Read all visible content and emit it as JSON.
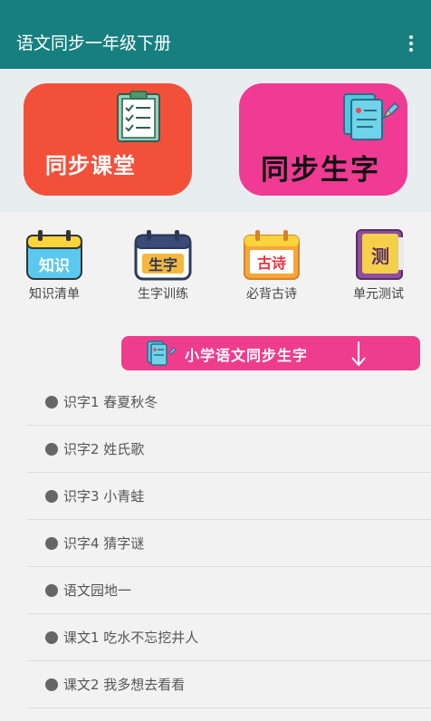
{
  "appbar": {
    "title": "语文同步一年级下册",
    "menu_icon": "more-vert-icon"
  },
  "banners": [
    {
      "label": "同步课堂",
      "icon": "clipboard-icon",
      "color": "#f3503a"
    },
    {
      "label": "同步生字",
      "icon": "notebook-pen-icon",
      "color": "#f03a93"
    }
  ],
  "grid": [
    {
      "label": "知识清单",
      "icon_text": "知识",
      "icon": "calendar-knowledge-icon"
    },
    {
      "label": "生字训练",
      "icon_text": "生字",
      "icon": "calendar-characters-icon"
    },
    {
      "label": "必背古诗",
      "icon_text": "古诗",
      "icon": "calendar-poem-icon"
    },
    {
      "label": "单元测试",
      "icon_text": "测",
      "icon": "test-book-icon"
    }
  ],
  "section": {
    "label": "小学语文同步生字",
    "icon": "notebook-pen-icon",
    "arrow_icon": "arrow-down-icon"
  },
  "lessons": [
    {
      "label": "识字1 春夏秋冬"
    },
    {
      "label": "识字2 姓氏歌"
    },
    {
      "label": "识字3 小青蛙"
    },
    {
      "label": "识字4 猜字谜"
    },
    {
      "label": "语文园地一"
    },
    {
      "label": "课文1 吃水不忘挖井人"
    },
    {
      "label": "课文2 我多想去看看"
    }
  ]
}
